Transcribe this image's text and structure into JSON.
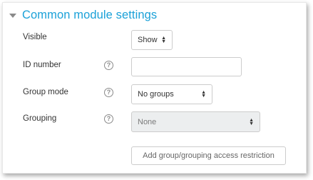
{
  "section": {
    "title": "Common module settings"
  },
  "fields": {
    "visible": {
      "label": "Visible",
      "value": "Show"
    },
    "id_number": {
      "label": "ID number",
      "value": ""
    },
    "group_mode": {
      "label": "Group mode",
      "value": "No groups"
    },
    "grouping": {
      "label": "Grouping",
      "value": "None"
    }
  },
  "help_icon_glyph": "?",
  "buttons": {
    "add_restriction": "Add group/grouping access restriction"
  },
  "colors": {
    "accent": "#1ba1d8",
    "disabled_bg": "#eceeef"
  }
}
